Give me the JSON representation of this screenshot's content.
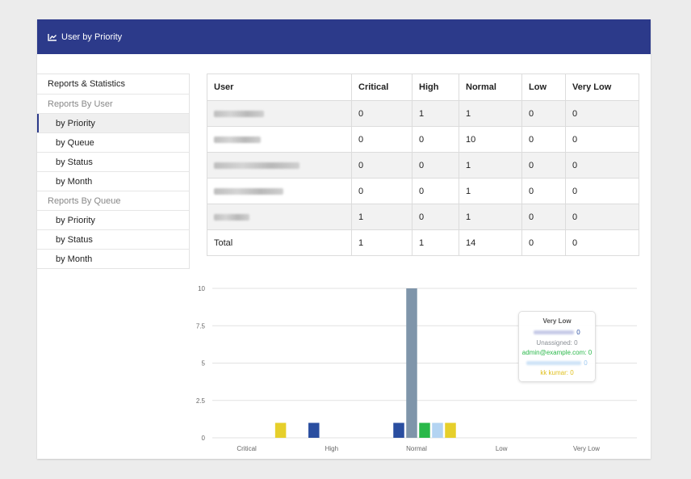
{
  "header": {
    "title": "User by Priority",
    "icon": "line-chart-icon"
  },
  "sidebar": {
    "items": [
      {
        "label": "Reports & Statistics",
        "kind": "top",
        "active": false
      },
      {
        "label": "Reports By User",
        "kind": "heading",
        "active": false
      },
      {
        "label": "by Priority",
        "kind": "sub",
        "active": true
      },
      {
        "label": "by Queue",
        "kind": "sub",
        "active": false
      },
      {
        "label": "by Status",
        "kind": "sub",
        "active": false
      },
      {
        "label": "by Month",
        "kind": "sub",
        "active": false
      },
      {
        "label": "Reports By Queue",
        "kind": "heading",
        "active": false
      },
      {
        "label": "by Priority",
        "kind": "sub",
        "active": false
      },
      {
        "label": "by Status",
        "kind": "sub",
        "active": false
      },
      {
        "label": "by Month",
        "kind": "sub",
        "active": false
      }
    ]
  },
  "table": {
    "headers": [
      "User",
      "Critical",
      "High",
      "Normal",
      "Low",
      "Very Low"
    ],
    "rows": [
      {
        "user": "",
        "values": [
          "0",
          "1",
          "1",
          "0",
          "0"
        ]
      },
      {
        "user": "",
        "values": [
          "0",
          "0",
          "10",
          "0",
          "0"
        ]
      },
      {
        "user": "",
        "values": [
          "0",
          "0",
          "1",
          "0",
          "0"
        ]
      },
      {
        "user": "",
        "values": [
          "0",
          "0",
          "1",
          "0",
          "0"
        ]
      },
      {
        "user": "",
        "values": [
          "1",
          "0",
          "1",
          "0",
          "0"
        ]
      }
    ],
    "total": {
      "label": "Total",
      "values": [
        "1",
        "1",
        "14",
        "0",
        "0"
      ]
    }
  },
  "chart_data": {
    "type": "bar",
    "categories": [
      "Critical",
      "High",
      "Normal",
      "Low",
      "Very Low"
    ],
    "ylim": [
      0,
      10
    ],
    "yticks": [
      "0",
      "2.5",
      "5",
      "7.5",
      "10"
    ],
    "grid": true,
    "series": [
      {
        "color": "#2a4ea0",
        "values": [
          0,
          1,
          1,
          0,
          0
        ]
      },
      {
        "color": "#7f95aa",
        "values": [
          0,
          0,
          10,
          0,
          0
        ]
      },
      {
        "color": "#2ab84a",
        "values": [
          0,
          0,
          1,
          0,
          0
        ]
      },
      {
        "color": "#b3d4f2",
        "values": [
          0,
          0,
          1,
          0,
          0
        ]
      },
      {
        "color": "#e6cf2b",
        "values": [
          1,
          0,
          1,
          0,
          0
        ]
      }
    ]
  },
  "tooltip": {
    "title": "Very Low",
    "rows": [
      {
        "text": "0",
        "color": "#2a4ea0"
      },
      {
        "text": "Unassigned: 0",
        "color": "#8a8f95"
      },
      {
        "text": "admin@example.com: 0",
        "color": "#2ab84a"
      },
      {
        "text": "0",
        "color": "#9cc8f0"
      },
      {
        "text": "kk kumar: 0",
        "color": "#e0c020"
      }
    ]
  }
}
